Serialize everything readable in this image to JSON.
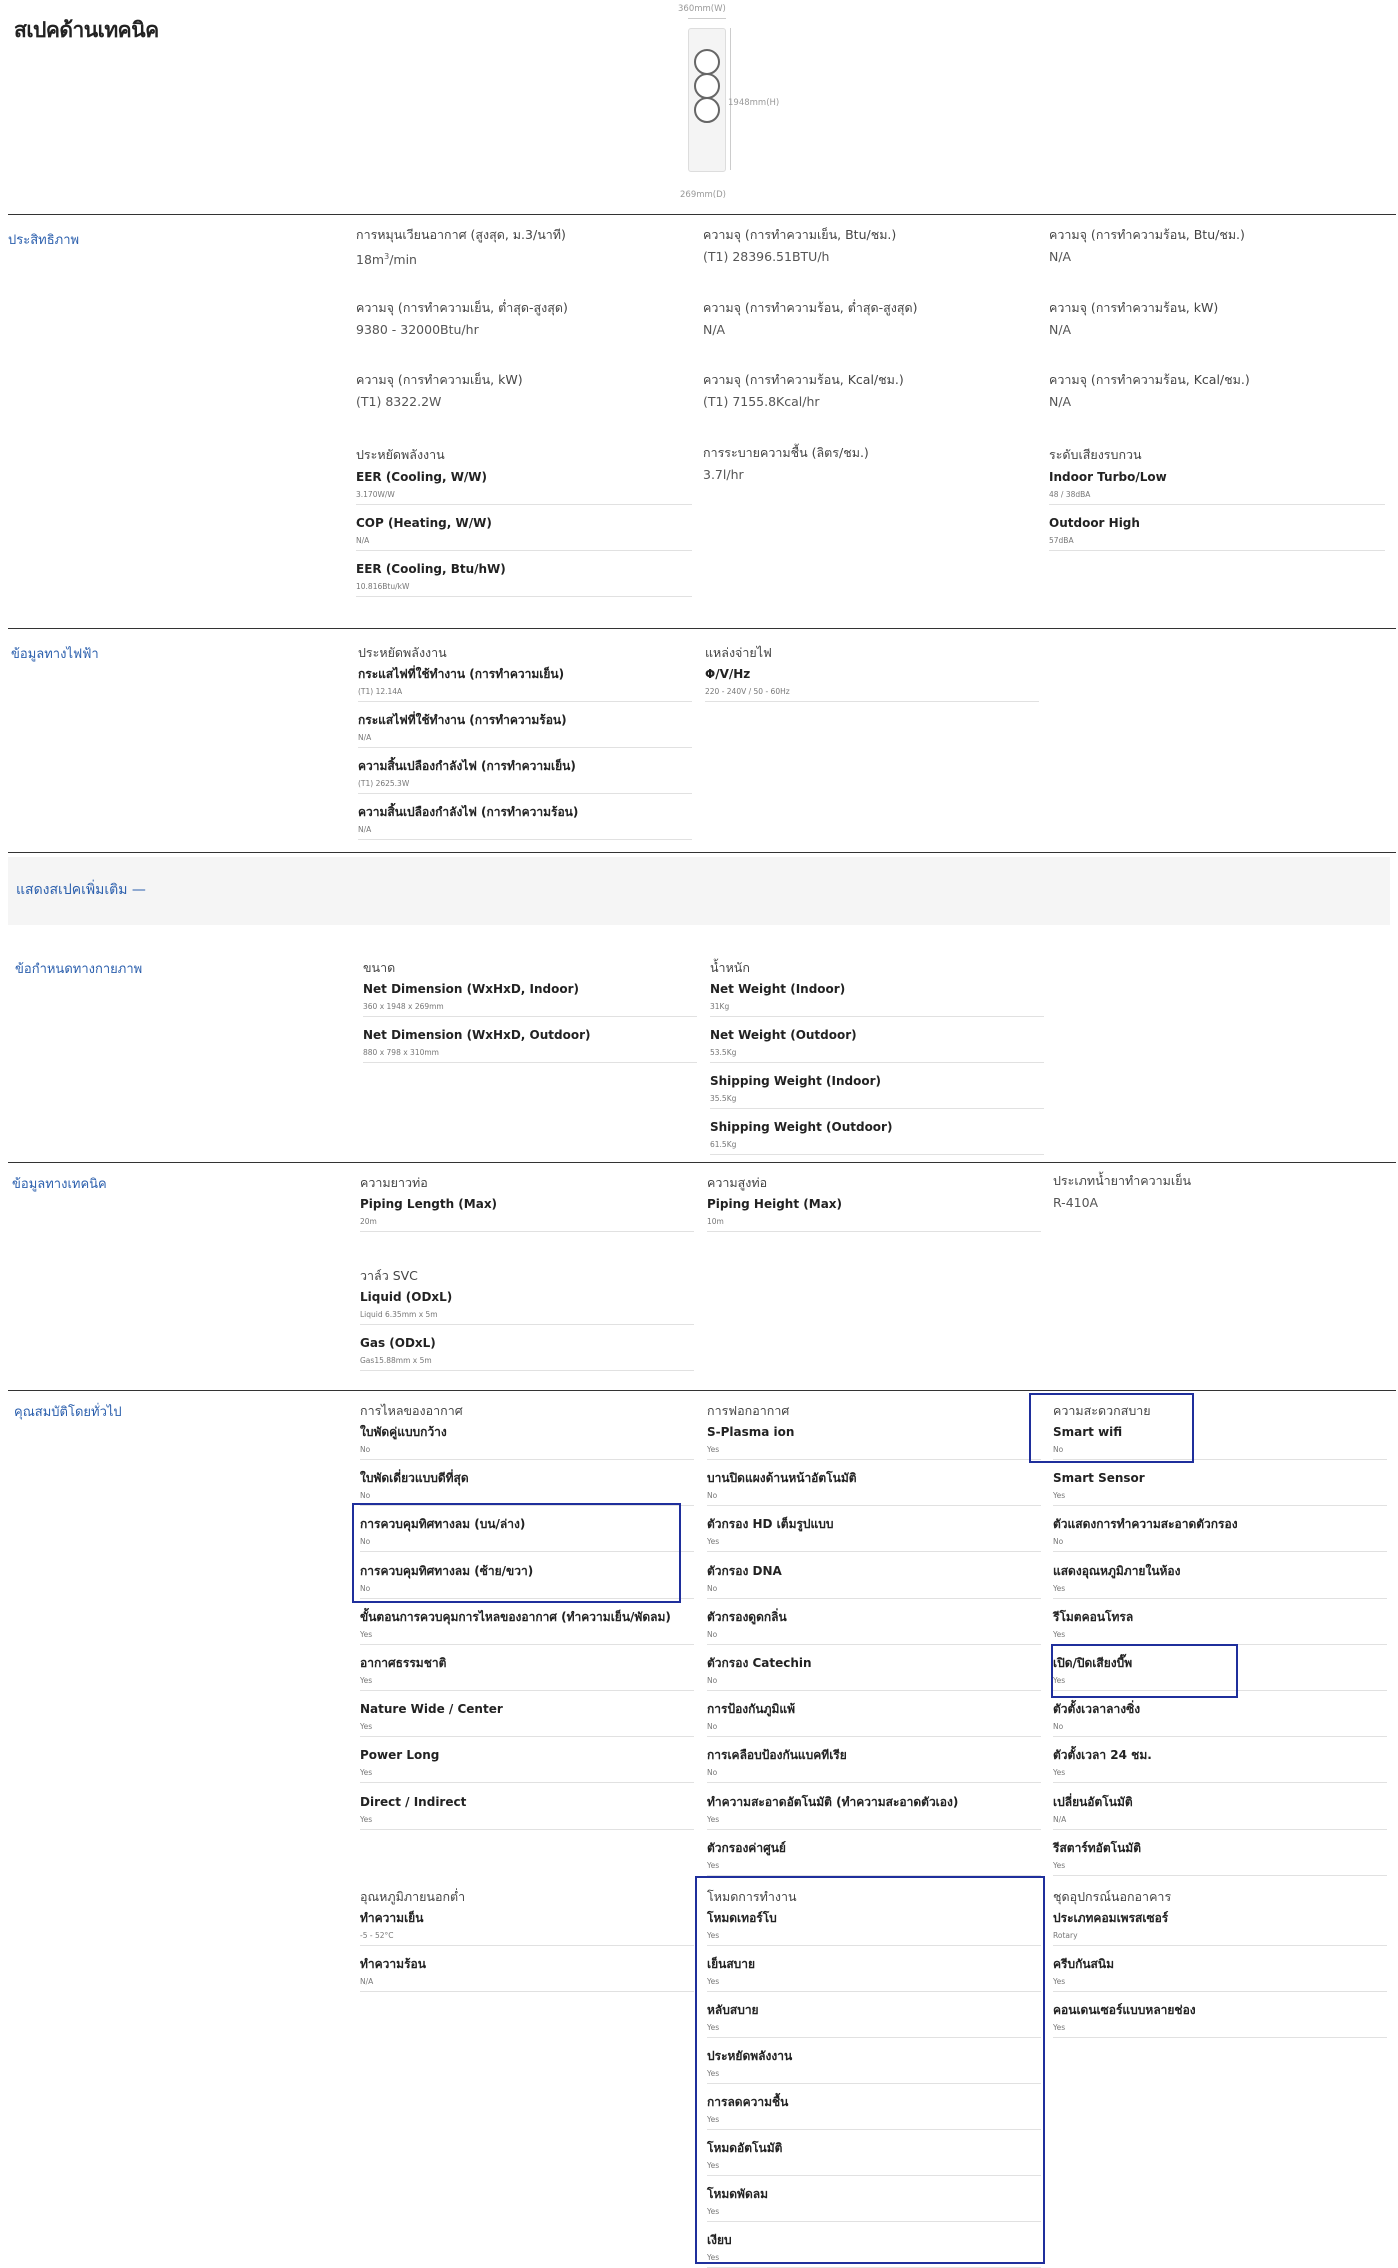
{
  "title": "สเปคด้านเทคนิค",
  "product_dims": {
    "w": "360mm(W)",
    "h": "1948mm(H)",
    "d": "269mm(D)"
  },
  "efficiency": {
    "label": "ประสิทธิภาพ",
    "cols": [
      [
        {
          "t": "การหมุนเวียนอากาศ (สูงสุด, ม.3/นาที)",
          "v": "18m³/min"
        },
        {
          "t": "ความจุ (การทำความเย็น, ต่ำสุด-สูงสุด)",
          "v": "9380 - 32000Btu/hr"
        },
        {
          "t": "ความจุ (การทำความเย็น, kW)",
          "v": "(T1) 8322.2W"
        }
      ],
      [
        {
          "t": "ความจุ (การทำความเย็น, Btu/ชม.)",
          "v": "(T1) 28396.51BTU/h"
        },
        {
          "t": "ความจุ (การทำความร้อน, ต่ำสุด-สูงสุด)",
          "v": "N/A"
        },
        {
          "t": "ความจุ (การทำความร้อน, Kcal/ชม.)",
          "v": "(T1) 7155.8Kcal/hr"
        }
      ],
      [
        {
          "t": "ความจุ (การทำความร้อน, Btu/ชม.)",
          "v": "N/A"
        },
        {
          "t": "ความจุ (การทำความร้อน, kW)",
          "v": "N/A"
        },
        {
          "t": "ความจุ (การทำความร้อน, Kcal/ชม.)",
          "v": "N/A"
        }
      ]
    ],
    "energy_group": {
      "title": "ประหยัดพลังงาน",
      "items": [
        {
          "t": "EER (Cooling, W/W)",
          "v": "3.170W/W"
        },
        {
          "t": "COP (Heating, W/W)",
          "v": "N/A"
        },
        {
          "t": "EER (Cooling, Btu/hW)",
          "v": "10.816Btu/kW"
        }
      ]
    },
    "dehumid": {
      "t": "การระบายความชื้น (ลิตร/ชม.)",
      "v": "3.7l/hr"
    },
    "noise_group": {
      "title": "ระดับเสียงรบกวน",
      "items": [
        {
          "t": "Indoor Turbo/Low",
          "v": "48 / 38dBA"
        },
        {
          "t": "Outdoor High",
          "v": "57dBA"
        }
      ]
    }
  },
  "electrical": {
    "label": "ข้อมูลทางไฟฟ้า",
    "energy_group": {
      "title": "ประหยัดพลังงาน",
      "items": [
        {
          "t": "กระแสไฟที่ใช้ทำงาน (การทำความเย็น)",
          "v": "(T1) 12.14A"
        },
        {
          "t": "กระแสไฟที่ใช้ทำงาน (การทำความร้อน)",
          "v": "N/A"
        },
        {
          "t": "ความสิ้นเปลืองกำลังไฟ (การทำความเย็น)",
          "v": "(T1) 2625.3W"
        },
        {
          "t": "ความสิ้นเปลืองกำลังไฟ (การทำความร้อน)",
          "v": "N/A"
        }
      ]
    },
    "power_group": {
      "title": "แหล่งจ่ายไฟ",
      "items": [
        {
          "t": "Φ/V/Hz",
          "v": "220 - 240V / 50 - 60Hz"
        }
      ]
    }
  },
  "more_specs": "แสดงสเปคเพิ่มเติม —",
  "physical": {
    "label": "ข้อกำหนดทางกายภาพ",
    "size_group": {
      "title": "ขนาด",
      "items": [
        {
          "t": "Net Dimension (WxHxD, Indoor)",
          "v": "360 x 1948 x 269mm"
        },
        {
          "t": "Net Dimension (WxHxD, Outdoor)",
          "v": "880 x 798 x 310mm"
        }
      ]
    },
    "weight_group": {
      "title": "น้ำหนัก",
      "items": [
        {
          "t": "Net Weight (Indoor)",
          "v": "31Kg"
        },
        {
          "t": "Net Weight (Outdoor)",
          "v": "53.5Kg"
        },
        {
          "t": "Shipping Weight (Indoor)",
          "v": "35.5Kg"
        },
        {
          "t": "Shipping Weight (Outdoor)",
          "v": "61.5Kg"
        }
      ]
    }
  },
  "technical": {
    "label": "ข้อมูลทางเทคนิค",
    "length_group": {
      "title": "ความยาวท่อ",
      "items": [
        {
          "t": "Piping Length (Max)",
          "v": "20m"
        }
      ]
    },
    "height_group": {
      "title": "ความสูงท่อ",
      "items": [
        {
          "t": "Piping Height (Max)",
          "v": "10m"
        }
      ]
    },
    "refrigerant": {
      "t": "ประเภทน้ำยาทำความเย็น",
      "v": "R-410A"
    },
    "svc_group": {
      "title": "วาล์ว SVC",
      "items": [
        {
          "t": "Liquid (ODxL)",
          "v": "Liquid 6.35mm x 5m"
        },
        {
          "t": "Gas (ODxL)",
          "v": "Gas15.88mm x 5m"
        }
      ]
    }
  },
  "features": {
    "label": "คุณสมบัติโดยทั่วไป",
    "col1": {
      "title": "การไหลของอากาศ",
      "items": [
        {
          "t": "ใบพัดคู่แบบกว้าง",
          "v": "No"
        },
        {
          "t": "ใบพัดเดี่ยวแบบดีที่สุด",
          "v": "No"
        },
        {
          "t": "การควบคุมทิศทางลม (บน/ล่าง)",
          "v": "No"
        },
        {
          "t": "การควบคุมทิศทางลม (ซ้าย/ขวา)",
          "v": "No"
        },
        {
          "t": "ขั้นตอนการควบคุมการไหลของอากาศ (ทำความเย็น/พัดลม)",
          "v": "Yes"
        },
        {
          "t": "อากาศธรรมชาติ",
          "v": "Yes"
        },
        {
          "t": "Nature Wide / Center",
          "v": "Yes"
        },
        {
          "t": "Power Long",
          "v": "Yes"
        },
        {
          "t": "Direct / Indirect",
          "v": "Yes"
        }
      ]
    },
    "col1b": {
      "title": "อุณหภูมิภายนอกต่ำ",
      "items": [
        {
          "t": "ทำความเย็น",
          "v": "-5 - 52°C"
        },
        {
          "t": "ทำความร้อน",
          "v": "N/A"
        }
      ]
    },
    "col2": {
      "title": "การฟอกอากาศ",
      "items": [
        {
          "t": "S-Plasma ion",
          "v": "Yes"
        },
        {
          "t": "บานปิดแผงด้านหน้าอัตโนมัติ",
          "v": "No"
        },
        {
          "t": "ตัวกรอง HD เต็มรูปแบบ",
          "v": "Yes"
        },
        {
          "t": "ตัวกรอง DNA",
          "v": "No"
        },
        {
          "t": "ตัวกรองดูดกลิ่น",
          "v": "No"
        },
        {
          "t": "ตัวกรอง Catechin",
          "v": "No"
        },
        {
          "t": "การป้องกันภูมิแพ้",
          "v": "No"
        },
        {
          "t": "การเคลือบป้องกันแบคทีเรีย",
          "v": "No"
        },
        {
          "t": "ทำความสะอาดอัตโนมัติ (ทำความสะอาดตัวเอง)",
          "v": "Yes"
        },
        {
          "t": "ตัวกรองค่าศูนย์",
          "v": "Yes"
        }
      ]
    },
    "col2b": {
      "title": "โหมดการทำงาน",
      "items": [
        {
          "t": "โหมดเทอร์โบ",
          "v": "Yes"
        },
        {
          "t": "เย็นสบาย",
          "v": "Yes"
        },
        {
          "t": "หลับสบาย",
          "v": "Yes"
        },
        {
          "t": "ประหยัดพลังงาน",
          "v": "Yes"
        },
        {
          "t": "การลดความชื้น",
          "v": "Yes"
        },
        {
          "t": "โหมดอัตโนมัติ",
          "v": "Yes"
        },
        {
          "t": "โหมดพัดลม",
          "v": "Yes"
        },
        {
          "t": "เงียบ",
          "v": "Yes"
        }
      ]
    },
    "col3": {
      "title": "ความสะดวกสบาย",
      "items": [
        {
          "t": "Smart wifi",
          "v": "No"
        },
        {
          "t": "Smart Sensor",
          "v": "Yes"
        },
        {
          "t": "ตัวแสดงการทำความสะอาดตัวกรอง",
          "v": "No"
        },
        {
          "t": "แสดงอุณหภูมิภายในห้อง",
          "v": "Yes"
        },
        {
          "t": "รีโมตคอนโทรล",
          "v": "Yes"
        },
        {
          "t": "เปิด/ปิดเสียงบี๊พ",
          "v": "Yes"
        },
        {
          "t": "ตัวตั้งเวลาลางซิ่ง",
          "v": "No"
        },
        {
          "t": "ตัวตั้งเวลา 24 ชม.",
          "v": "Yes"
        },
        {
          "t": "เปลี่ยนอัตโนมัติ",
          "v": "N/A"
        },
        {
          "t": "รีสตาร์ทอัตโนมัติ",
          "v": "Yes"
        }
      ]
    },
    "col3b": {
      "title": "ชุดอุปกรณ์นอกอาคาร",
      "items": [
        {
          "t": "ประเภทคอมเพรสเซอร์",
          "v": "Rotary"
        },
        {
          "t": "ครีบกันสนิม",
          "v": "Yes"
        },
        {
          "t": "คอนเดนเซอร์แบบหลายช่อง",
          "v": "Yes"
        }
      ]
    }
  }
}
